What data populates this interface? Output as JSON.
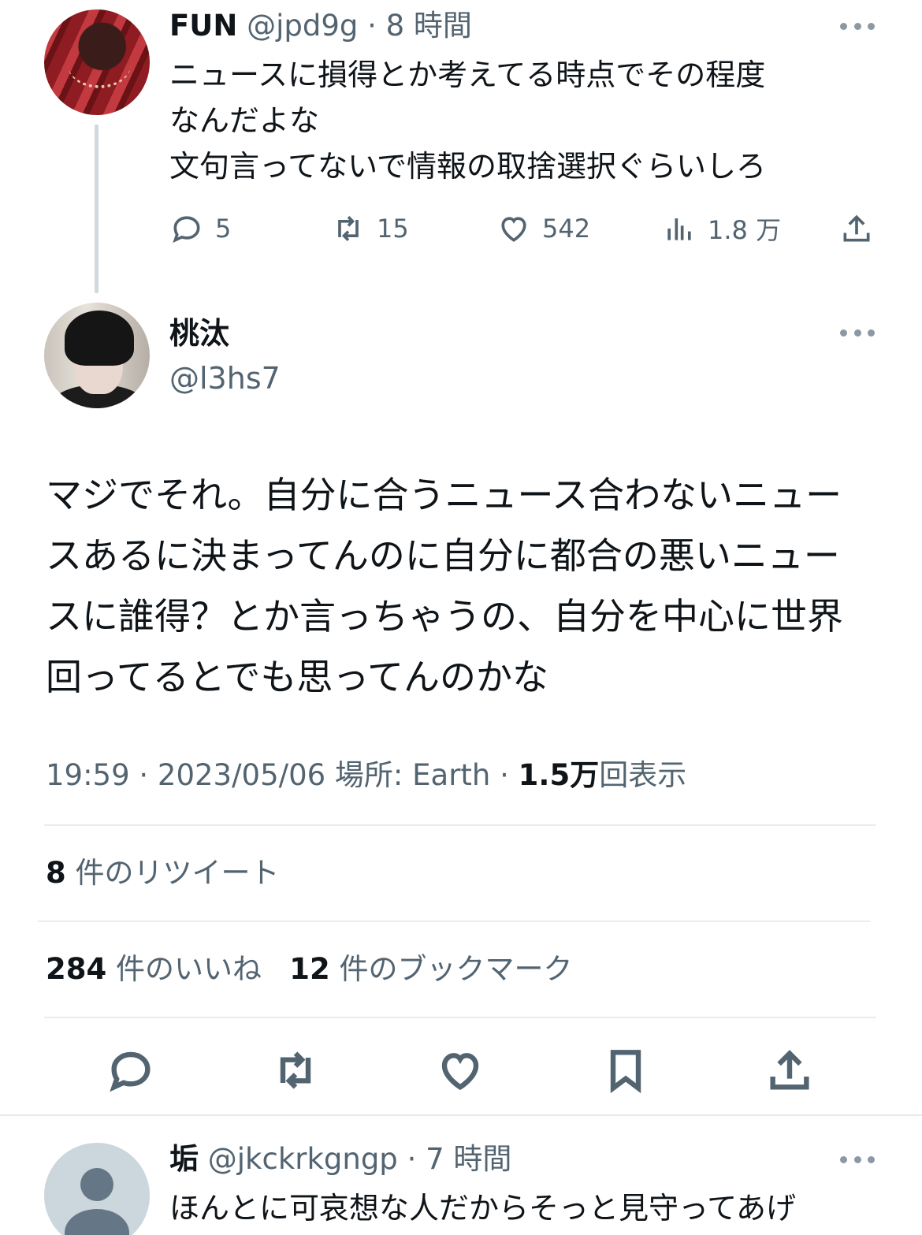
{
  "parent_tweet": {
    "display_name": "FUN",
    "handle": "@jpd9g",
    "time": "· 8 時間",
    "lines": [
      "ニュースに損得とか考えてる時点でその程度",
      "なんだよな",
      "文句言ってないで情報の取捨選択ぐらいしろ"
    ],
    "replies": "5",
    "retweets": "15",
    "likes": "542",
    "views": "1.8 万"
  },
  "main_tweet": {
    "display_name": "桃汰",
    "handle": "@l3hs7",
    "lines": [
      "マジでそれ。自分に合うニュース合わないニュー",
      "スあるに決まってんのに自分に都合の悪いニュー",
      "スに誰得？とか言っちゃうの、自分を中心に世界",
      "回ってるとでも思ってんのかな"
    ],
    "timestamp_prefix": "19:59 · 2023/05/06 場所: Earth · ",
    "view_count": "1.5万",
    "view_suffix": "回表示",
    "retweet_count": "8",
    "retweet_label": " 件のリツイート",
    "like_count": "284",
    "like_label": " 件のいいね",
    "bookmark_count": "12",
    "bookmark_label": " 件のブックマーク"
  },
  "reply_tweet": {
    "display_name": "垢",
    "handle": "@jkckrkgngp",
    "time": "· 7 時間",
    "line": "ほんとに可哀想な人だからそっと見守ってあげ"
  },
  "icons": {
    "reply": "reply-icon",
    "retweet": "retweet-icon",
    "like": "heart-icon",
    "views": "views-icon",
    "share": "share-icon",
    "bookmark": "bookmark-icon",
    "more": "more-icon"
  },
  "colors": {
    "text_primary": "#0f1419",
    "text_secondary": "#536471",
    "divider": "#e6ecf0"
  }
}
